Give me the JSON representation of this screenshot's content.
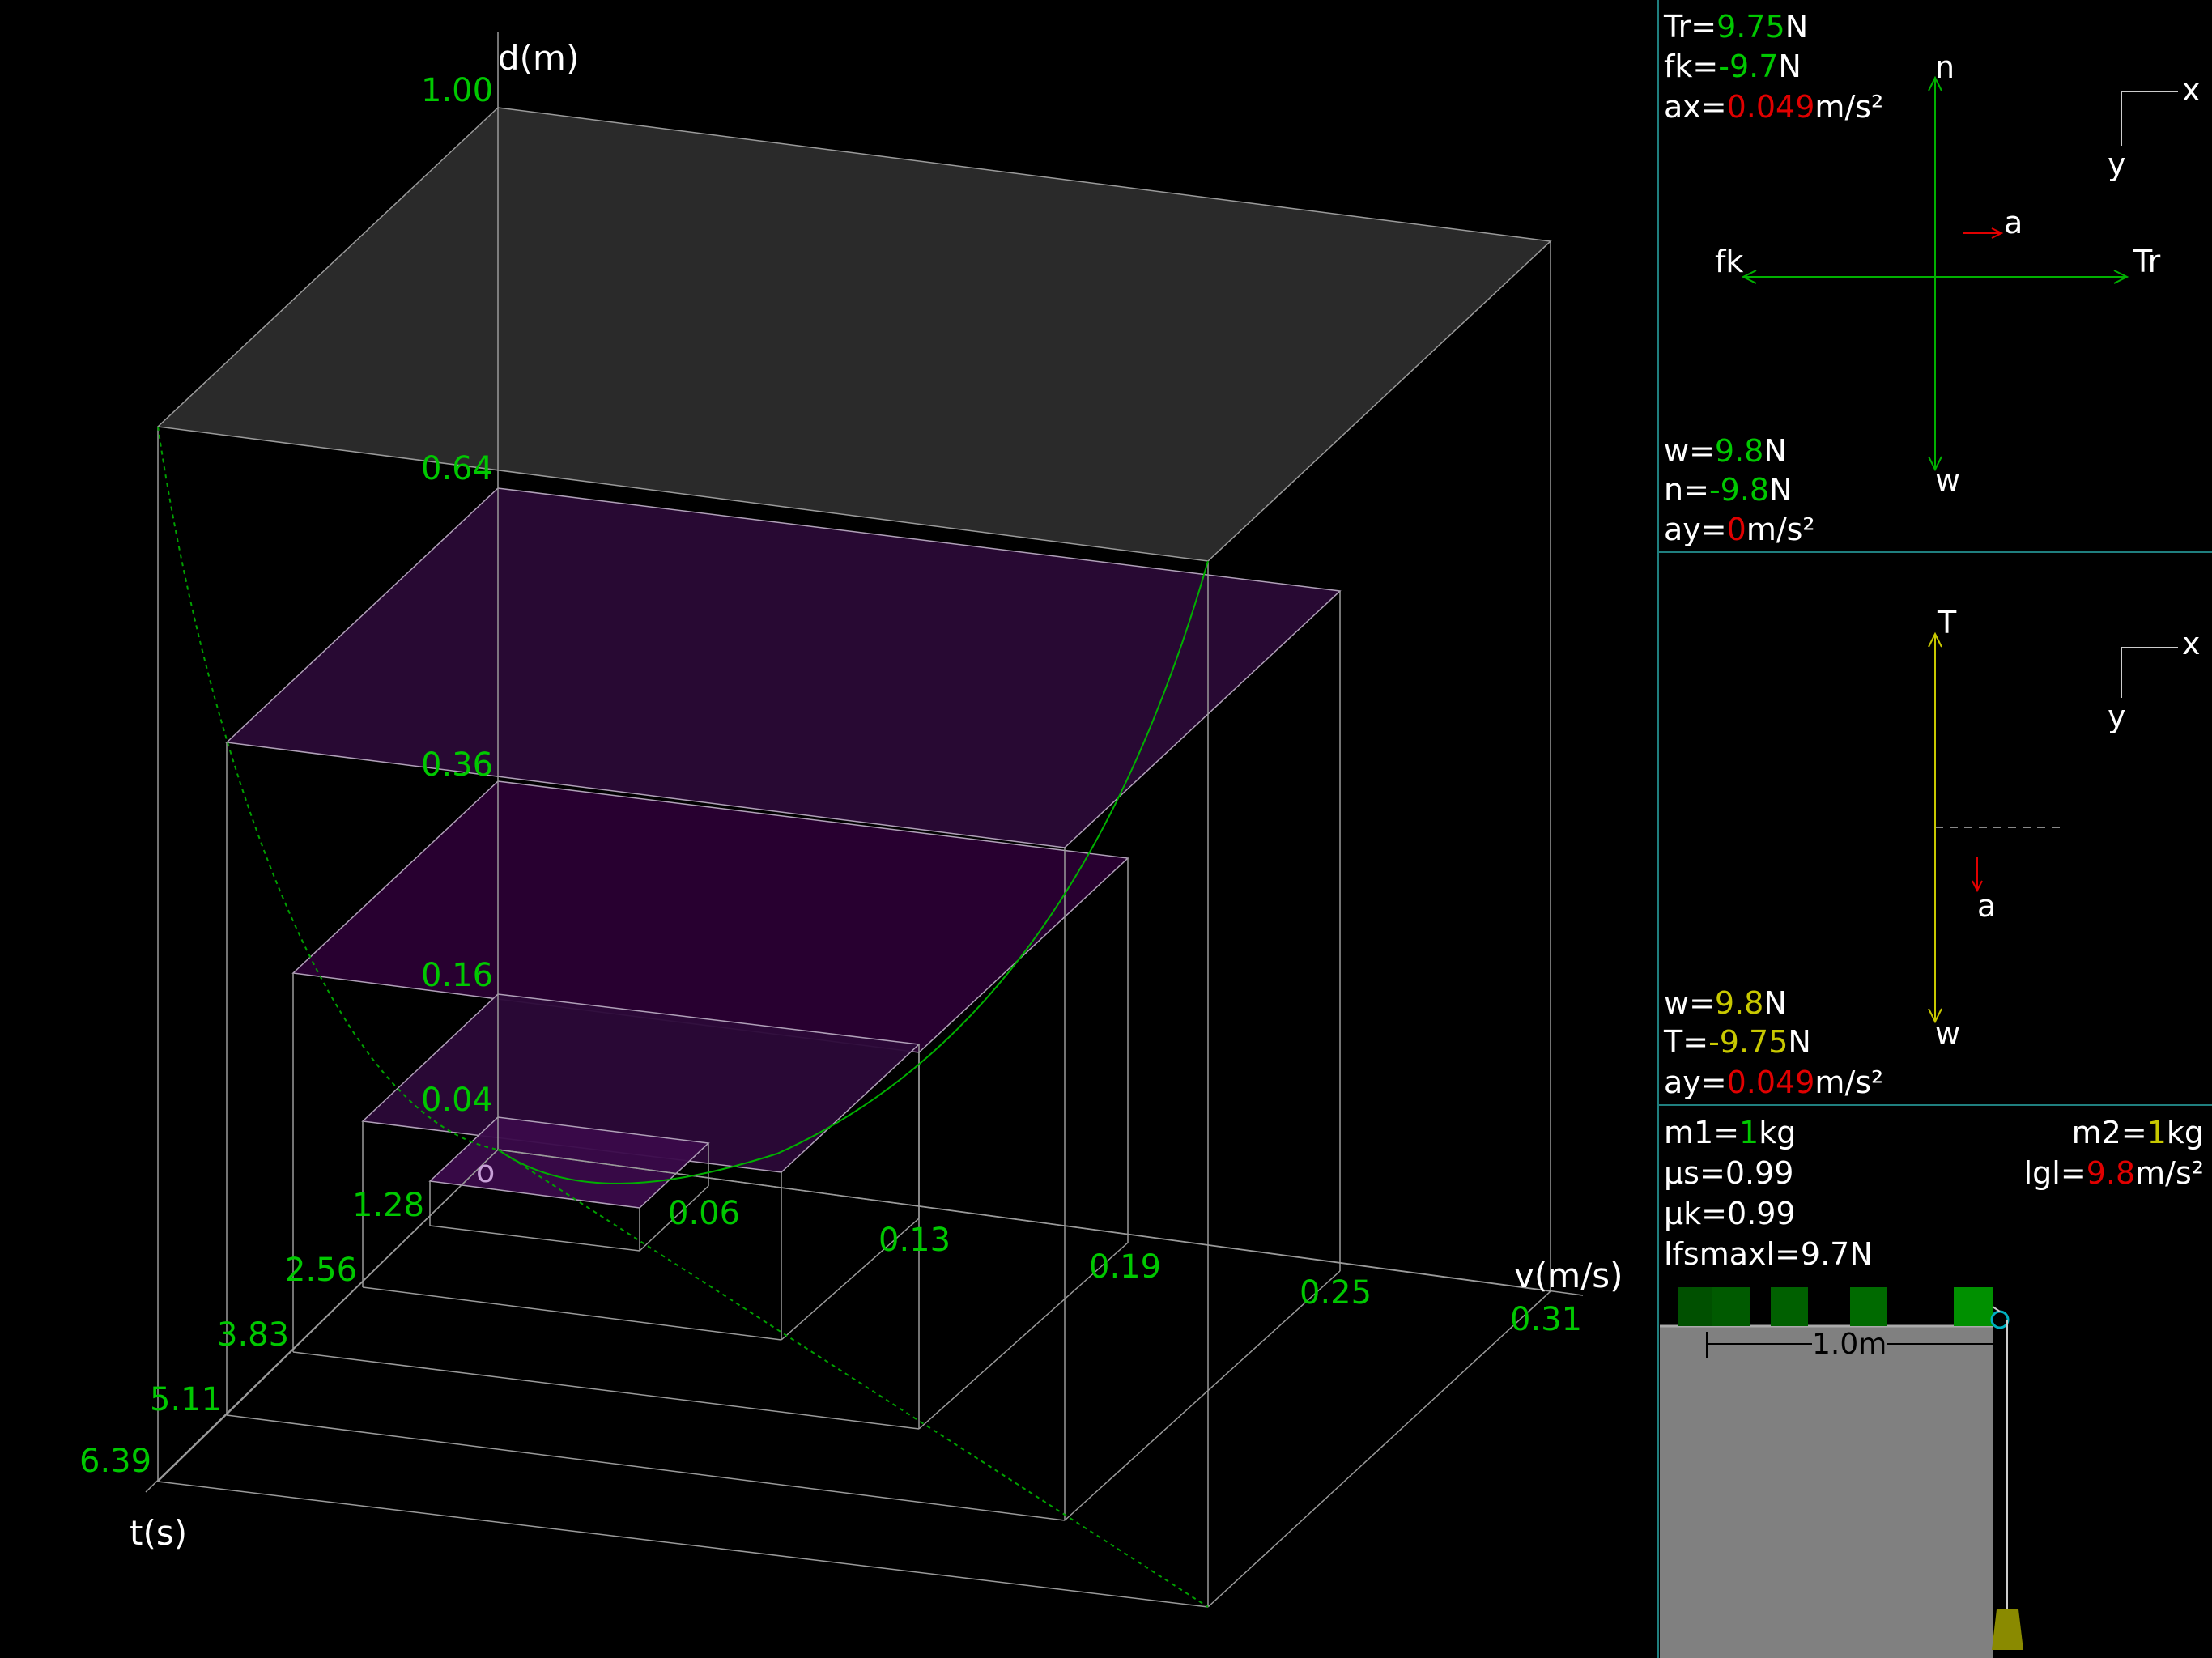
{
  "colors": {
    "value_green": "#00c800",
    "value_yellow": "#c8c800",
    "value_red": "#e00000",
    "panel_border": "#1f7f7f",
    "plane_purple": "#3a0a4a",
    "top_plane": "#2a2a2a",
    "ground": "#808080",
    "block": "#008000"
  },
  "graph3d": {
    "axis_d_label": "d(m)",
    "axis_v_label": "v(m/s)",
    "axis_t_label": "t(s)",
    "origin_label": "o",
    "d_ticks": [
      "1.00",
      "0.64",
      "0.36",
      "0.16",
      "0.04"
    ],
    "v_ticks": [
      "0.06",
      "0.13",
      "0.19",
      "0.25",
      "0.31"
    ],
    "t_ticks": [
      "1.28",
      "2.56",
      "3.83",
      "5.11",
      "6.39"
    ]
  },
  "panel1": {
    "Tr": {
      "label": "Tr=",
      "value": "9.75",
      "unit": "N"
    },
    "fk": {
      "label": "fk=",
      "value": "-9.7",
      "unit": "N"
    },
    "ax": {
      "label": "ax=",
      "value": "0.049",
      "unit": "m/s²"
    },
    "w": {
      "label": "w=",
      "value": "9.8",
      "unit": "N"
    },
    "n": {
      "label": "n=",
      "value": "-9.8",
      "unit": "N"
    },
    "ay": {
      "label": "ay=",
      "value": "0",
      "unit": "m/s²"
    },
    "arrow_n": "n",
    "arrow_w": "w",
    "arrow_fk": "fk",
    "arrow_Tr": "Tr",
    "arrow_a": "a",
    "axis_x": "x",
    "axis_y": "y"
  },
  "panel2": {
    "w": {
      "label": "w=",
      "value": "9.8",
      "unit": "N"
    },
    "T": {
      "label": "T=",
      "value": "-9.75",
      "unit": "N"
    },
    "ay": {
      "label": "ay=",
      "value": "0.049",
      "unit": "m/s²"
    },
    "arrow_T": "T",
    "arrow_w": "w",
    "arrow_a": "a",
    "axis_x": "x",
    "axis_y": "y"
  },
  "panel3": {
    "m1": {
      "label": "m1=",
      "value": "1",
      "unit": "kg"
    },
    "mus": "μs=0.99",
    "muk": "μk=0.99",
    "fsmax": "lfsmaxl=9.7N",
    "m2": {
      "label": "m2=",
      "value": "1",
      "unit": "kg"
    },
    "g": {
      "label": "lgl=",
      "value": "9.8",
      "unit": "m/s²"
    },
    "distance": "1.0m"
  }
}
